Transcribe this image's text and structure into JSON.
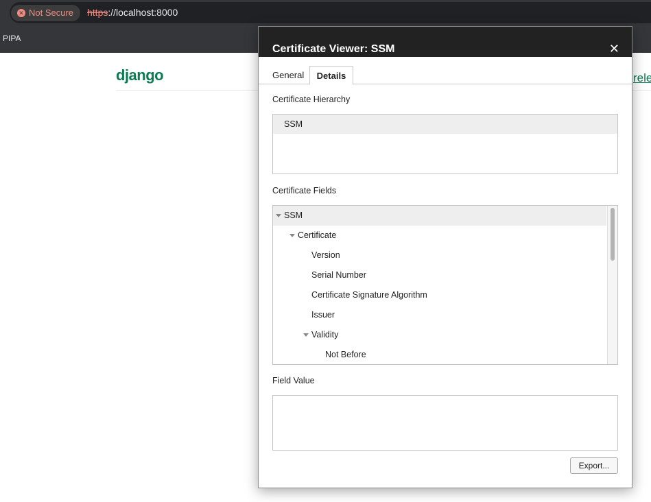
{
  "browser": {
    "security_chip": "Not Secure",
    "url_scheme": "https",
    "url_rest": "://localhost:8000",
    "bookmark": "PIPA"
  },
  "page": {
    "logo": "django",
    "link_partial": "rele"
  },
  "dialog": {
    "title": "Certificate Viewer: SSM",
    "tabs": [
      {
        "label": "General",
        "active": false
      },
      {
        "label": "Details",
        "active": true
      }
    ],
    "hierarchy_label": "Certificate Hierarchy",
    "hierarchy_items": [
      "SSM"
    ],
    "fields_label": "Certificate Fields",
    "fields": [
      {
        "label": "SSM",
        "level": 0,
        "expanded": true
      },
      {
        "label": "Certificate",
        "level": 1,
        "expanded": true
      },
      {
        "label": "Version",
        "level": 2
      },
      {
        "label": "Serial Number",
        "level": 2
      },
      {
        "label": "Certificate Signature Algorithm",
        "level": 2
      },
      {
        "label": "Issuer",
        "level": 2
      },
      {
        "label": "Validity",
        "level": 2,
        "expanded": true
      },
      {
        "label": "Not Before",
        "level": 3
      }
    ],
    "field_value_label": "Field Value",
    "field_value": "",
    "export_button": "Export..."
  }
}
